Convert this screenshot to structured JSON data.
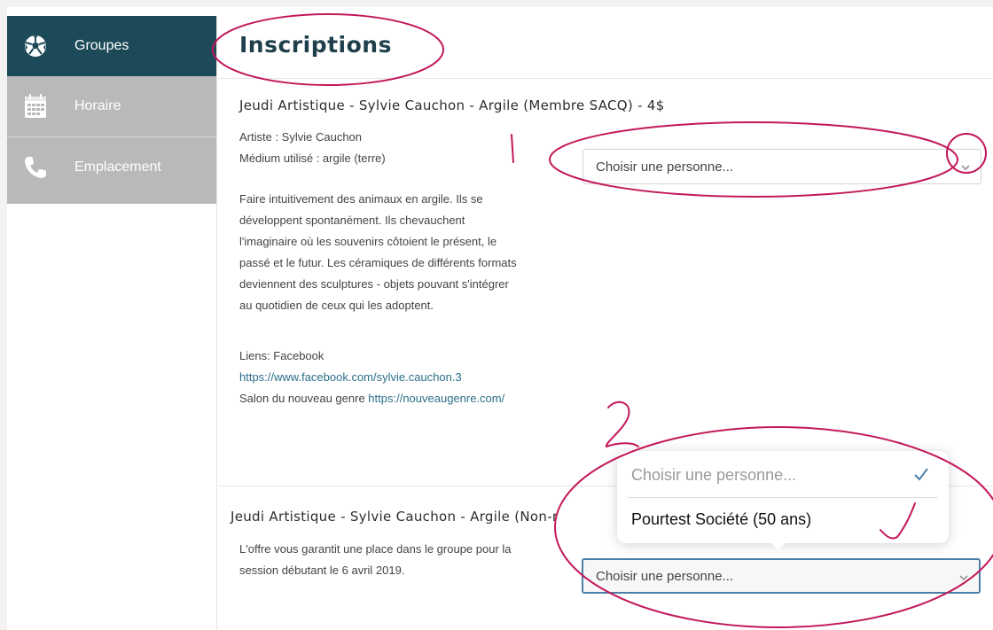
{
  "sidebar": {
    "items": [
      {
        "label": "Groupes",
        "icon": "soccer-ball-icon",
        "active": true
      },
      {
        "label": "Horaire",
        "icon": "calendar-icon",
        "active": false
      },
      {
        "label": "Emplacement",
        "icon": "phone-icon",
        "active": false
      }
    ]
  },
  "page": {
    "title": "Inscriptions"
  },
  "card1": {
    "title": "Jeudi Artistique - Sylvie Cauchon - Argile (Membre SACQ) - 4$",
    "artist": "Artiste : Sylvie Cauchon",
    "medium": "Médium utilisé : argile (terre)",
    "description": [
      "Faire intuitivement des animaux en argile. Ils se",
      "développent spontanément.  Ils chevauchent",
      "l'imaginaire où les souvenirs côtoient le présent, le",
      "passé et le futur.  Les céramiques de différents formats",
      "deviennent des sculptures - objets pouvant s'intégrer",
      "au  quotidien de ceux qui les adoptent."
    ],
    "links_label": "Liens: Facebook",
    "facebook_url": "https://www.facebook.com/sylvie.cauchon.3",
    "salon_prefix": "Salon du nouveau genre ",
    "salon_url": "https://nouveaugenre.com/",
    "select_value": "Choisir une personne..."
  },
  "card2": {
    "title": "Jeudi Artistique - Sylvie Cauchon - Argile (Non-r",
    "line1": "L'offre vous garantit une place dans le groupe pour la",
    "line2": "session débutant le 6 avril 2019.",
    "select_value": "Choisir une personne..."
  },
  "picker": {
    "options": [
      "Choisir une personne...",
      "Pourtest Société (50 ans)"
    ]
  },
  "annotations": {
    "number_2": "2"
  },
  "colors": {
    "sidebar_active": "#1d4a58",
    "sidebar_inactive": "#b9b9b9",
    "title": "#1e3f4b",
    "link": "#2c6f88",
    "annotation": "#c2185b"
  }
}
